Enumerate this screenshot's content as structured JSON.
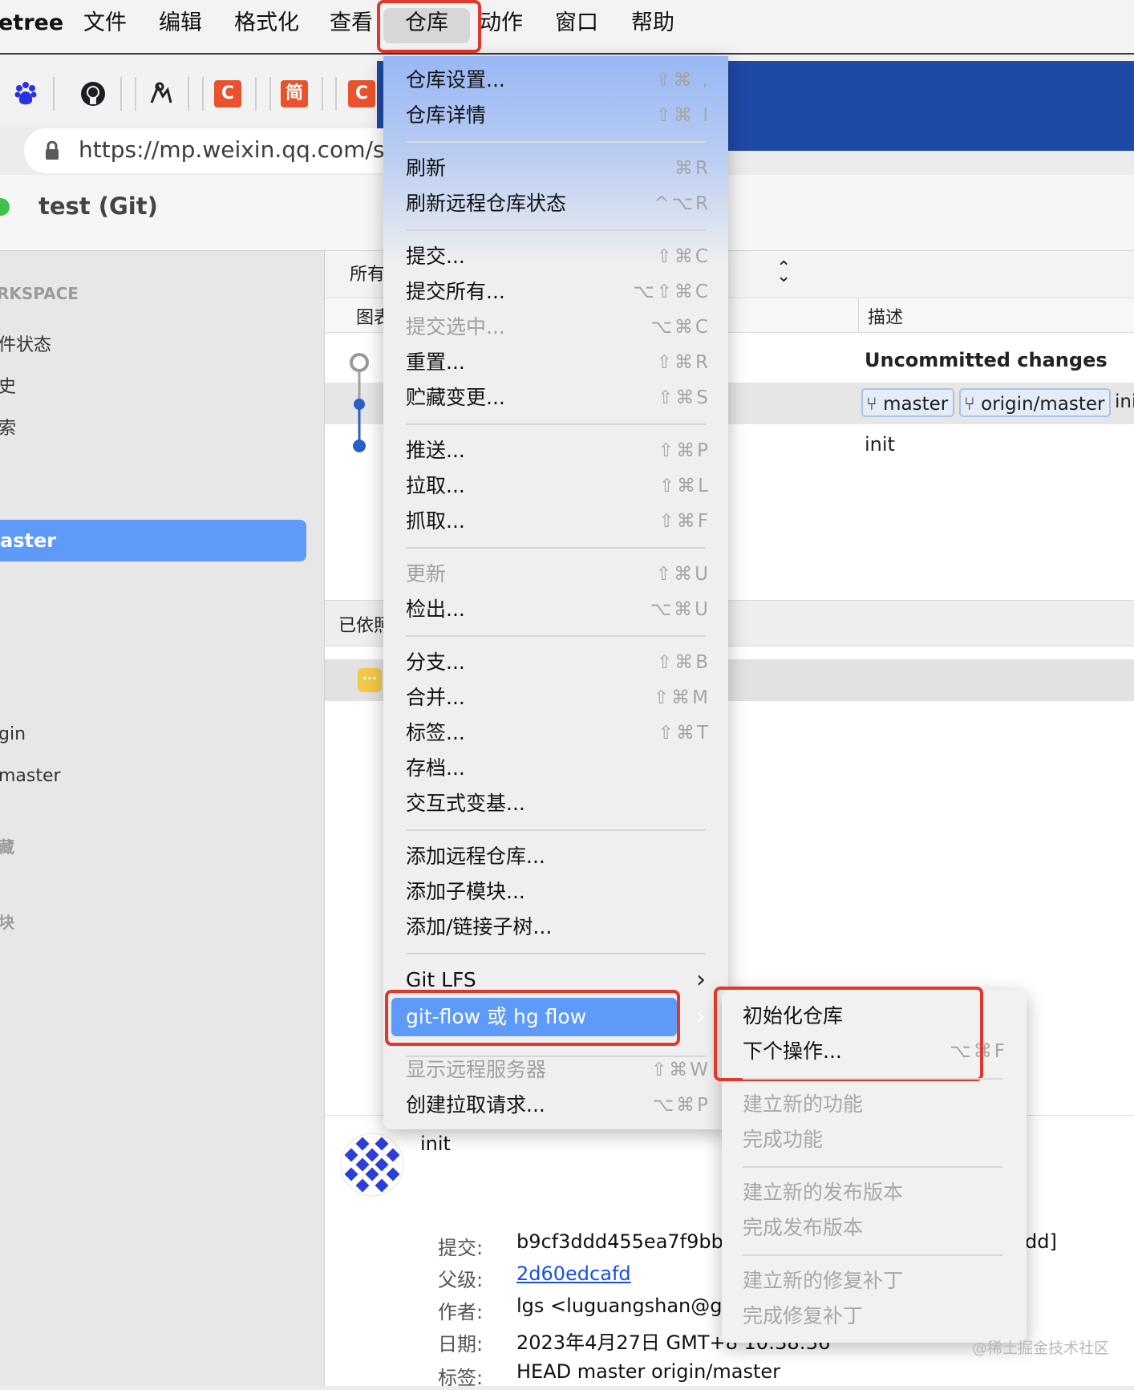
{
  "menubar": {
    "app": "etree",
    "items": [
      "文件",
      "编辑",
      "格式化",
      "查看",
      "仓库",
      "动作",
      "窗口",
      "帮助"
    ]
  },
  "browser": {
    "url": "https://mp.weixin.qq.com/s?",
    "bookmark_labels": [
      "C",
      "简",
      "C"
    ]
  },
  "window": {
    "title": "test (Git)"
  },
  "sidebar": {
    "workspace_header": "RKSPACE",
    "items": [
      "件状态",
      "史",
      "索"
    ],
    "selected_branch": "aster",
    "remote": "gin",
    "remote_branch": "master",
    "stash_header": "藏",
    "submodule_header": "块"
  },
  "main": {
    "filter_label": "所有",
    "col_graph": "图表",
    "col_desc": "描述",
    "uncommitted": "Uncommitted changes",
    "tags": [
      "master",
      "origin/master"
    ],
    "tag_trail": "ini",
    "commit_msg": "init",
    "file_status_label": "已依照",
    "badge": "···",
    "detail": {
      "message": "init",
      "labels": {
        "commit": "提交:",
        "parent": "父级:",
        "author": "作者:",
        "date": "日期:",
        "tags": "标签:"
      },
      "commit": "b9cf3ddd455ea7f9bb7",
      "commit_tail": "dd]",
      "parent": "2d60edcafd",
      "author": "lgs <luguangshan@git",
      "date": "2023年4月27日 GMT+8 10:38:36",
      "tags": "HEAD master origin/master"
    }
  },
  "menu": {
    "items": [
      {
        "label": "仓库设置...",
        "shortcut": "⇧⌘ ,"
      },
      {
        "label": "仓库详情",
        "shortcut": "⇧⌘ I"
      },
      {
        "label": "刷新",
        "shortcut": "⌘R"
      },
      {
        "label": "刷新远程仓库状态",
        "shortcut": "^⌥R"
      },
      {
        "label": "提交...",
        "shortcut": "⇧⌘C"
      },
      {
        "label": "提交所有...",
        "shortcut": "⌥⇧⌘C"
      },
      {
        "label": "提交选中...",
        "shortcut": "⌥⌘C"
      },
      {
        "label": "重置...",
        "shortcut": "⇧⌘R"
      },
      {
        "label": "贮藏变更...",
        "shortcut": "⇧⌘S"
      },
      {
        "label": "推送...",
        "shortcut": "⇧⌘P"
      },
      {
        "label": "拉取...",
        "shortcut": "⇧⌘L"
      },
      {
        "label": "抓取...",
        "shortcut": "⇧⌘F"
      },
      {
        "label": "更新",
        "shortcut": "⇧⌘U"
      },
      {
        "label": "检出...",
        "shortcut": "⌥⌘U"
      },
      {
        "label": "分支...",
        "shortcut": "⇧⌘B"
      },
      {
        "label": "合并...",
        "shortcut": "⇧⌘M"
      },
      {
        "label": "标签...",
        "shortcut": "⇧⌘T"
      },
      {
        "label": "存档...",
        "shortcut": ""
      },
      {
        "label": "交互式变基...",
        "shortcut": ""
      },
      {
        "label": "添加远程仓库...",
        "shortcut": ""
      },
      {
        "label": "添加子模块...",
        "shortcut": ""
      },
      {
        "label": "添加/链接子树...",
        "shortcut": ""
      },
      {
        "label": "Git LFS",
        "shortcut": ""
      },
      {
        "label": "git-flow 或 hg flow",
        "shortcut": ""
      },
      {
        "label": "显示远程服务器",
        "shortcut": "⇧⌘W"
      },
      {
        "label": "创建拉取请求...",
        "shortcut": "⌥⌘P"
      }
    ]
  },
  "submenu": {
    "items": [
      {
        "label": "初始化仓库",
        "shortcut": ""
      },
      {
        "label": "下个操作...",
        "shortcut": "⌥⌘F"
      },
      {
        "label": "建立新的功能",
        "shortcut": ""
      },
      {
        "label": "完成功能",
        "shortcut": ""
      },
      {
        "label": "建立新的发布版本",
        "shortcut": ""
      },
      {
        "label": "完成发布版本",
        "shortcut": ""
      },
      {
        "label": "建立新的修复补丁",
        "shortcut": ""
      },
      {
        "label": "完成修复补丁",
        "shortcut": ""
      }
    ]
  },
  "colors": {
    "accent": "#5e9af7",
    "annotation_red": "#e2382b",
    "graph_blue": "#2a5fc8"
  },
  "watermark": "@稀土掘金技术社区"
}
